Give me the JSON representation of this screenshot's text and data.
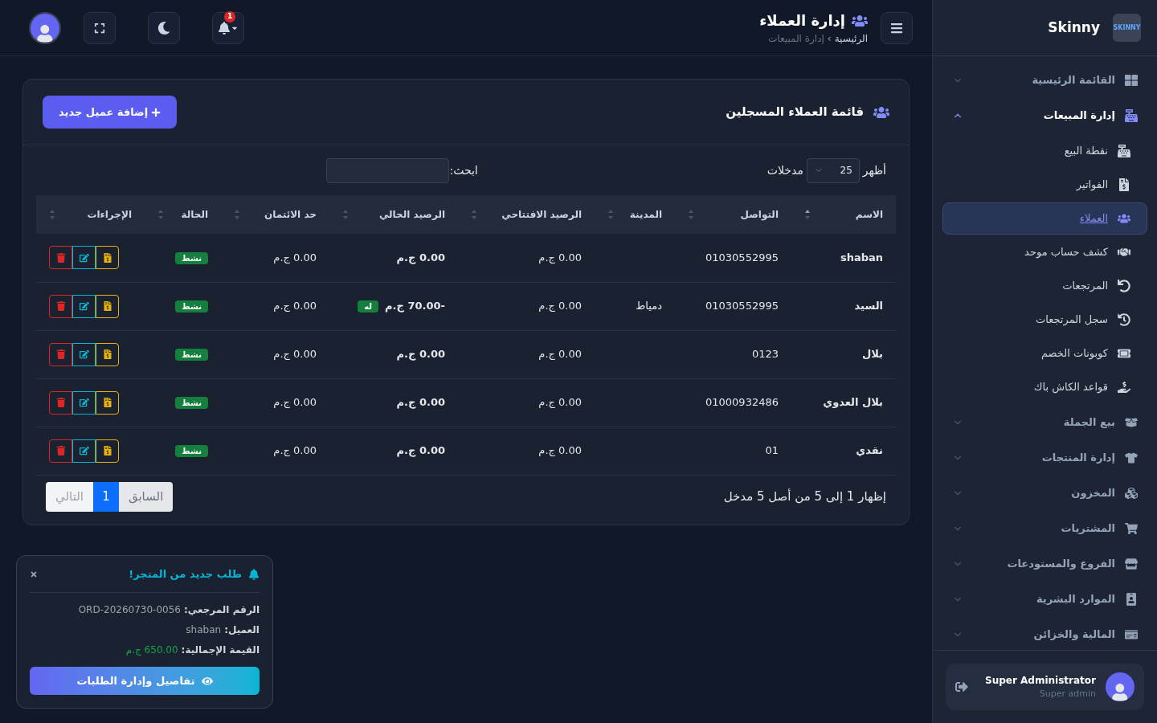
{
  "sidebar": {
    "brand": "Skinny",
    "logo_text": "SKINNY",
    "items": [
      {
        "label": "القائمة الرئيسية",
        "expanded": false
      },
      {
        "label": "إدارة المبيعات",
        "expanded": true,
        "children": [
          {
            "label": "نقطة البيع",
            "selected": false
          },
          {
            "label": "الفواتير",
            "selected": false
          },
          {
            "label": "العملاء",
            "selected": true
          },
          {
            "label": "كشف حساب موحد",
            "selected": false
          },
          {
            "label": "المرتجعات",
            "selected": false
          },
          {
            "label": "سجل المرتجعات",
            "selected": false
          },
          {
            "label": "كوبونات الخصم",
            "selected": false
          },
          {
            "label": "قواعد الكاش باك",
            "selected": false
          }
        ]
      },
      {
        "label": "بيع الجملة",
        "expanded": false
      },
      {
        "label": "إدارة المنتجات",
        "expanded": false
      },
      {
        "label": "المخزون",
        "expanded": false
      },
      {
        "label": "المشتريات",
        "expanded": false
      },
      {
        "label": "الفروع والمستودعات",
        "expanded": false
      },
      {
        "label": "الموارد البشرية",
        "expanded": false
      },
      {
        "label": "المالية والخزائن",
        "expanded": false
      }
    ],
    "user": {
      "name": "Super Administrator",
      "role": "Super admin"
    }
  },
  "header": {
    "title": "إدارة العملاء",
    "breadcrumb": [
      "الرئيسية",
      "إدارة المبيعات"
    ],
    "breadcrumb_separator": "›",
    "notification_count": "1"
  },
  "card": {
    "title": "قائمة العملاء المسجلين",
    "add_button": "إضافة عميل جديد",
    "show_label": "أظهر",
    "page_size": "25",
    "entries_label": "مدخلات",
    "search_label": "ابحث:",
    "columns": [
      {
        "label": "الاسم",
        "sorted": true
      },
      {
        "label": "التواصل",
        "sorted": false
      },
      {
        "label": "المدينة",
        "sorted": false
      },
      {
        "label": "الرصيد الافتتاحي",
        "sorted": false
      },
      {
        "label": "الرصيد الحالي",
        "sorted": false
      },
      {
        "label": "حد الائتمان",
        "sorted": false
      },
      {
        "label": "الحالة",
        "sorted": false
      },
      {
        "label": "الإجراءات",
        "sorted": false
      }
    ],
    "rows": [
      {
        "name": "shaban",
        "phone": "01030552995",
        "city": "",
        "opening": "0.00 ج.م",
        "balance": "0.00 ج.م",
        "balance_tag": "",
        "credit": "0.00 ج.م",
        "status": "نشط"
      },
      {
        "name": "السيد",
        "phone": "01030552995",
        "city": "دمياط",
        "opening": "0.00 ج.م",
        "balance": "-70.00 ج.م",
        "balance_tag": "له",
        "credit": "0.00 ج.م",
        "status": "نشط"
      },
      {
        "name": "بلال",
        "phone": "0123",
        "city": "",
        "opening": "0.00 ج.م",
        "balance": "0.00 ج.م",
        "balance_tag": "",
        "credit": "0.00 ج.م",
        "status": "نشط"
      },
      {
        "name": "بلال العدوي",
        "phone": "01000932486",
        "city": "",
        "opening": "0.00 ج.م",
        "balance": "0.00 ج.م",
        "balance_tag": "",
        "credit": "0.00 ج.م",
        "status": "نشط"
      },
      {
        "name": "نقدي",
        "phone": "01",
        "city": "",
        "opening": "0.00 ج.م",
        "balance": "0.00 ج.م",
        "balance_tag": "",
        "credit": "0.00 ج.م",
        "status": "نشط"
      }
    ],
    "info": "إظهار 1 إلى 5 من أصل 5 مدخل",
    "pagination": {
      "previous": "السابق",
      "pages": [
        {
          "label": "1",
          "selected": true
        }
      ],
      "next": "التالي"
    }
  },
  "toast": {
    "title": "طلب جديد من المتجر!",
    "lines": [
      {
        "label": "الرقم المرجعي:",
        "value": "ORD-20260730-0056",
        "kind": "plain"
      },
      {
        "label": "العميل:",
        "value": "shaban",
        "kind": "plain"
      },
      {
        "label": "القيمة الإجمالية:",
        "value": "650.00 ج.م",
        "kind": "money"
      }
    ],
    "button": "تفاصيل وإدارة الطلبات"
  }
}
